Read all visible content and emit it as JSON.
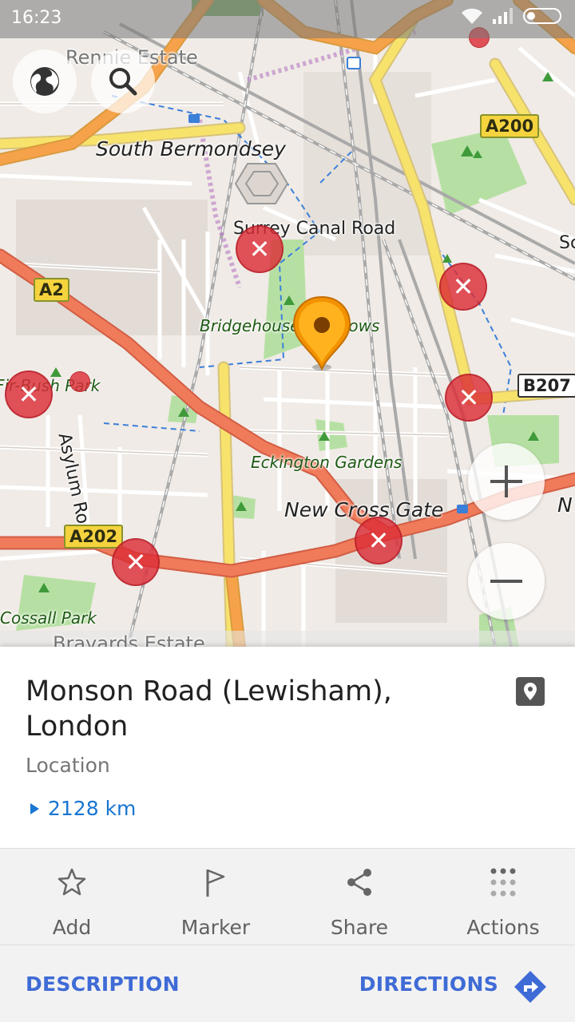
{
  "status_bar": {
    "time": "16:23"
  },
  "map": {
    "labels": {
      "rennie_estate": "Rennie Estate",
      "south_bermondsey": "South Bermondsey",
      "surrey_canal_road": "Surrey Canal Road",
      "bridgehouse_meadows": "Bridgehouse Meadows",
      "bush_park": "Fir-Bush Park",
      "asylum_road": "Asylum Road",
      "eckington_gardens": "Eckington Gardens",
      "new_cross_gate": "New Cross Gate",
      "cossall_park": "Cossall Park",
      "brayards_estate": "Brayards Estate",
      "edge_sc": "Sc",
      "edge_n": "N"
    },
    "shields": {
      "a200": "A200",
      "a2": "A2",
      "b207": "B207",
      "a202": "A202"
    },
    "buttons": {
      "globe": "globe-icon",
      "search": "search-icon",
      "zoom_in": "+",
      "zoom_out": "−"
    }
  },
  "place": {
    "title": "Monson Road (Lewisham), London",
    "type": "Location",
    "distance": "2128 km"
  },
  "actions": [
    {
      "label": "Add",
      "icon": "star-icon"
    },
    {
      "label": "Marker",
      "icon": "flag-icon"
    },
    {
      "label": "Share",
      "icon": "share-icon"
    },
    {
      "label": "Actions",
      "icon": "dots-grid-icon"
    }
  ],
  "links": {
    "description": "DESCRIPTION",
    "directions": "DIRECTIONS"
  },
  "colors": {
    "accent": "#3f6bd6",
    "distance": "#1976d2",
    "marker_pin": "#f39200",
    "favorite_marker": "#dc2d37",
    "major_road": "#f07b5a",
    "secondary_road": "#f5e06a",
    "park": "#b6e0a3"
  }
}
